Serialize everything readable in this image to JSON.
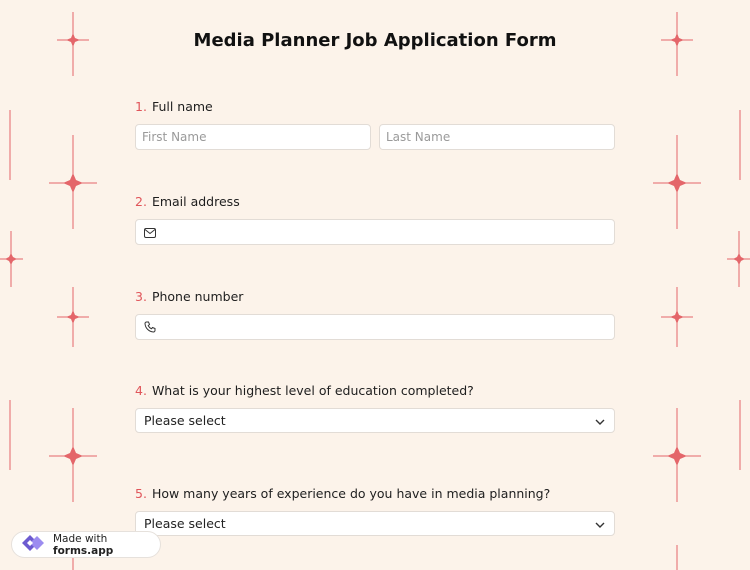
{
  "form": {
    "title": "Media Planner Job Application Form"
  },
  "questions": [
    {
      "number": "1.",
      "label": "Full name",
      "first_placeholder": "First Name",
      "last_placeholder": "Last Name"
    },
    {
      "number": "2.",
      "label": "Email address",
      "icon": "envelope-icon"
    },
    {
      "number": "3.",
      "label": "Phone number",
      "icon": "phone-icon"
    },
    {
      "number": "4.",
      "label": "What is your highest level of education completed?",
      "select_value": "Please select"
    },
    {
      "number": "5.",
      "label": "How many years of experience do you have in media planning?",
      "select_value": "Please select"
    }
  ],
  "badge": {
    "prefix": "Made with",
    "brand": "forms.app"
  },
  "colors": {
    "background": "#fcf3ea",
    "accent": "#e0555a",
    "sparkle": "#e4666a"
  }
}
